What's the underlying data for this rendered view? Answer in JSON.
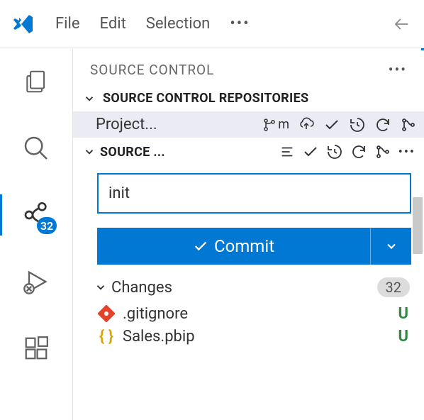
{
  "menu": {
    "file": "File",
    "edit": "Edit",
    "selection": "Selection"
  },
  "panel": {
    "title": "SOURCE CONTROL"
  },
  "repos_section": {
    "title": "SOURCE CONTROL REPOSITORIES",
    "repo": "Project...",
    "branch": "m"
  },
  "sc_section": {
    "title": "SOURCE ..."
  },
  "commit": {
    "message": "init",
    "button": "Commit"
  },
  "changes": {
    "label": "Changes",
    "count": "32"
  },
  "files": [
    {
      "name": ".gitignore",
      "status": "U"
    },
    {
      "name": "Sales.pbip",
      "status": "U"
    }
  ],
  "badge": "32"
}
